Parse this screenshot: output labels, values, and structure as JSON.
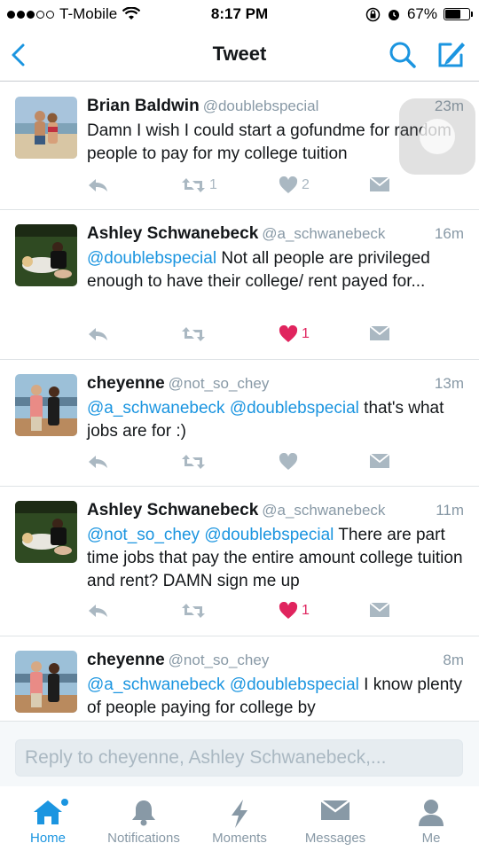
{
  "status_bar": {
    "carrier": "T-Mobile",
    "time": "8:17 PM",
    "battery": "67%",
    "battery_level": 0.67
  },
  "nav": {
    "title": "Tweet",
    "back_icon": "chevron-left-icon",
    "search_icon": "search-icon",
    "compose_icon": "compose-icon"
  },
  "tweets": [
    {
      "name": "Brian Baldwin",
      "handle": "@doublebspecial",
      "time": "23m",
      "text": [
        {
          "t": "Damn I wish I could start a gofundme for random people to pay for my college tuition",
          "mention": false
        }
      ],
      "retweets": "1",
      "likes": "2",
      "liked": false
    },
    {
      "name": "Ashley Schwanebeck",
      "handle": "@a_schwanebeck",
      "time": "16m",
      "text": [
        {
          "t": "@doublebspecial",
          "mention": true
        },
        {
          "t": " Not all people are privileged enough to have their college/ rent payed for...",
          "mention": false
        }
      ],
      "retweets": "",
      "likes": "1",
      "liked": true
    },
    {
      "name": "cheyenne",
      "handle": "@not_so_chey",
      "time": "13m",
      "text": [
        {
          "t": "@a_schwanebeck",
          "mention": true
        },
        {
          "t": " ",
          "mention": false
        },
        {
          "t": "@doublebspecial",
          "mention": true
        },
        {
          "t": " that's what jobs are for :)",
          "mention": false
        }
      ],
      "retweets": "",
      "likes": "",
      "liked": false
    },
    {
      "name": "Ashley Schwanebeck",
      "handle": "@a_schwanebeck",
      "time": "11m",
      "text": [
        {
          "t": "@not_so_chey",
          "mention": true
        },
        {
          "t": " ",
          "mention": false
        },
        {
          "t": "@doublebspecial",
          "mention": true
        },
        {
          "t": " There are part time jobs that pay the entire amount college tuition and rent? DAMN sign me up",
          "mention": false
        }
      ],
      "retweets": "",
      "likes": "1",
      "liked": true
    },
    {
      "name": "cheyenne",
      "handle": "@not_so_chey",
      "time": "8m",
      "text": [
        {
          "t": "@a_schwanebeck",
          "mention": true
        },
        {
          "t": " ",
          "mention": false
        },
        {
          "t": "@doublebspecial",
          "mention": true
        },
        {
          "t": " I know plenty of people paying for college by",
          "mention": false
        }
      ],
      "retweets": "",
      "likes": "",
      "liked": false
    }
  ],
  "reply": {
    "placeholder": "Reply to cheyenne, Ashley Schwanebeck,..."
  },
  "tabs": [
    {
      "label": "Home",
      "icon": "home-icon",
      "active": true
    },
    {
      "label": "Notifications",
      "icon": "notifications-icon",
      "active": false
    },
    {
      "label": "Moments",
      "icon": "moments-icon",
      "active": false
    },
    {
      "label": "Messages",
      "icon": "messages-icon",
      "active": false
    },
    {
      "label": "Me",
      "icon": "me-icon",
      "active": false
    }
  ],
  "colors": {
    "accent": "#1b95e0",
    "like": "#e0245e",
    "muted": "#8899a6"
  }
}
